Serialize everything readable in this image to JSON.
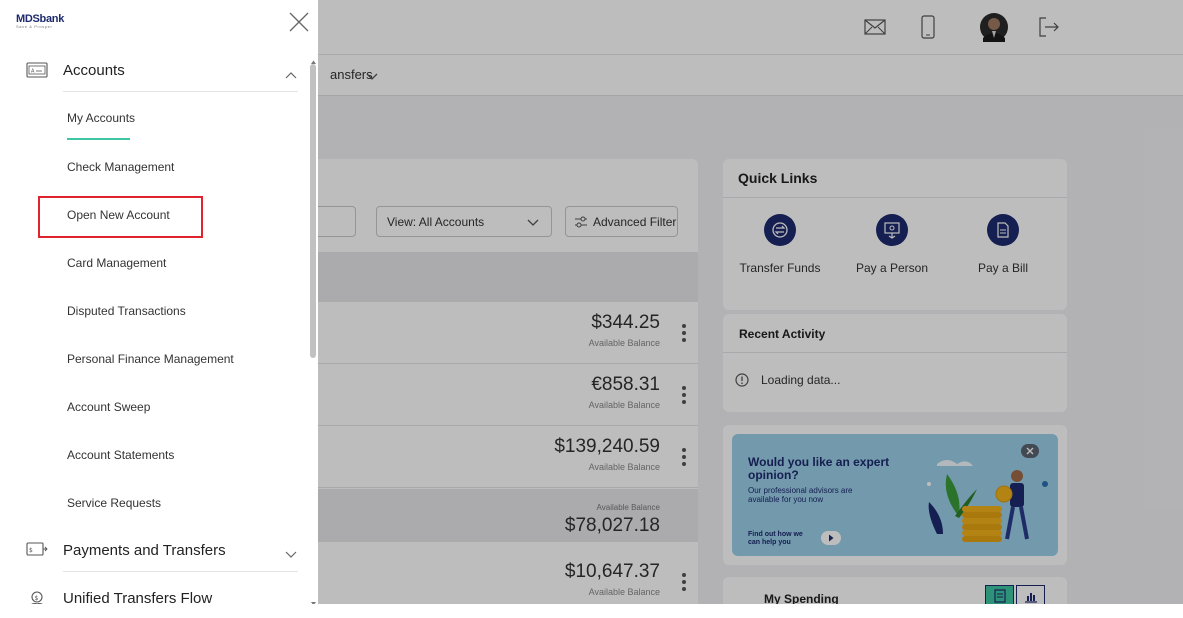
{
  "brand": {
    "logo_text": "MDSbank",
    "tagline": "Save & Prosper"
  },
  "header": {
    "icons": [
      "mail-icon",
      "mobile-icon",
      "avatar",
      "logout-icon"
    ]
  },
  "subnav": {
    "partial_crumb": "ansfers"
  },
  "accounts_panel": {
    "view_label": "View: All Accounts",
    "advanced_filter_label": "Advanced Filter",
    "rows": [
      {
        "amount": "$344.25",
        "caption": "Available Balance"
      },
      {
        "amount": "€858.31",
        "caption": "Available Balance"
      },
      {
        "amount": "$139,240.59",
        "caption": "Available Balance"
      }
    ],
    "group_total": {
      "caption": "Available Balance",
      "amount": "$78,027.18"
    },
    "last_row": {
      "amount": "$10,647.37",
      "caption": "Available Balance"
    }
  },
  "quick_links": {
    "title": "Quick Links",
    "items": [
      {
        "label": "Transfer Funds",
        "icon": "transfer-icon"
      },
      {
        "label": "Pay a Person",
        "icon": "pay-person-icon"
      },
      {
        "label": "Pay a Bill",
        "icon": "bill-icon"
      }
    ]
  },
  "recent_activity": {
    "title": "Recent Activity",
    "status": "Loading data..."
  },
  "promo": {
    "title": "Would you like an expert opinion?",
    "subtitle": "Our professional advisors are available for you now",
    "link": "Find out how we can help you"
  },
  "spending": {
    "title": "My Spending"
  },
  "sidebar": {
    "sections": [
      {
        "label": "Accounts",
        "icon": "accounts-card-icon",
        "expanded": true
      },
      {
        "label": "Payments and Transfers",
        "icon": "payments-icon",
        "expanded": false
      },
      {
        "label": "Unified Transfers Flow",
        "icon": "unified-transfers-icon",
        "expanded": false
      }
    ],
    "account_items": [
      {
        "label": "My Accounts",
        "active": true
      },
      {
        "label": "Check Management"
      },
      {
        "label": "Open New Account",
        "highlighted": true
      },
      {
        "label": "Card Management"
      },
      {
        "label": "Disputed Transactions"
      },
      {
        "label": "Personal Finance Management"
      },
      {
        "label": "Account Sweep"
      },
      {
        "label": "Account Statements"
      },
      {
        "label": "Service Requests"
      }
    ],
    "colors": {
      "active_underline": "#3dc6a3",
      "highlight_border": "#e0242e",
      "brand_navy": "#1d2a6e"
    }
  }
}
